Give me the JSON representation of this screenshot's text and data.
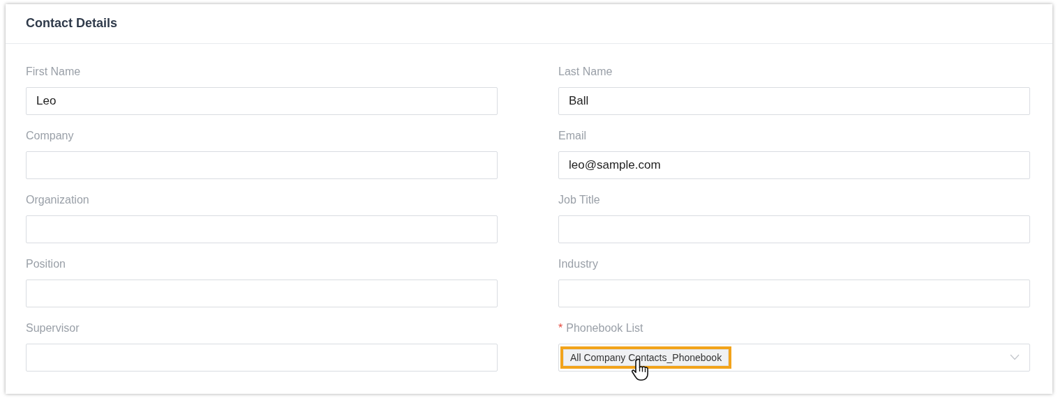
{
  "card": {
    "title": "Contact Details"
  },
  "fields": [
    {
      "kind": "text",
      "label": "First Name",
      "value": "Leo"
    },
    {
      "kind": "text",
      "label": "Last Name",
      "value": "Ball"
    },
    {
      "kind": "text",
      "label": "Company"
    },
    {
      "kind": "text",
      "label": "Email",
      "value": "leo@sample.com"
    },
    {
      "kind": "text",
      "label": "Organization"
    },
    {
      "kind": "text",
      "label": "Job Title"
    },
    {
      "kind": "text",
      "label": "Position"
    },
    {
      "kind": "text",
      "label": "Industry"
    },
    {
      "kind": "text",
      "label": "Supervisor"
    },
    {
      "kind": "select",
      "label": "Phonebook List",
      "required_mark": "*",
      "tags": [
        {
          "label": "All Company Contacts_Phonebook",
          "highlighted": true
        }
      ]
    }
  ]
}
